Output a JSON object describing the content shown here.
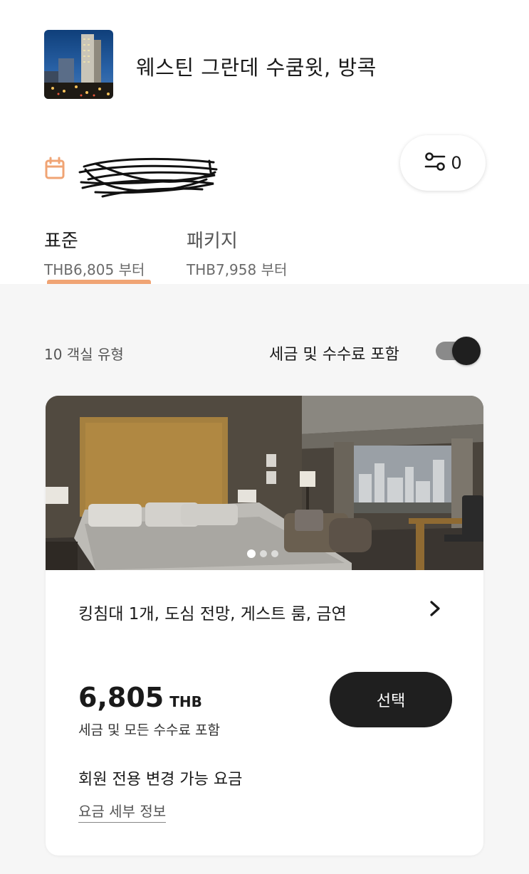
{
  "header": {
    "hotel_name": "웨스틴 그란데 수쿰윗, 방콕",
    "hotel_thumbnail": "hotel-exterior-night-photo"
  },
  "dates": {
    "icon": "calendar-icon",
    "value_redacted": true
  },
  "filter": {
    "icon": "filter-sliders-icon",
    "count": "0"
  },
  "tabs": [
    {
      "label": "표준",
      "price": "THB6,805 부터",
      "active": true
    },
    {
      "label": "패키지",
      "price": "THB7,958 부터",
      "active": false
    }
  ],
  "summary": {
    "room_count": "10 객실 유형",
    "tax_toggle_label": "세금 및 수수료 포함",
    "tax_toggle_on": true
  },
  "room": {
    "photo": "hotel-room-king-bed-city-view",
    "carousel_total": 3,
    "carousel_current": 1,
    "title": "킹침대 1개, 도심 전망, 게스트 룸, 금연",
    "price_amount": "6,805",
    "price_currency": "THB",
    "price_note": "세금 및 모든 수수료 포함",
    "select_label": "선택",
    "rate_name": "회원 전용 변경 가능 요금",
    "rate_details_link": "요금 세부 정보"
  },
  "colors": {
    "accent": "#f0a474",
    "button_dark": "#1f1f1f",
    "background_gray": "#f6f6f6"
  }
}
